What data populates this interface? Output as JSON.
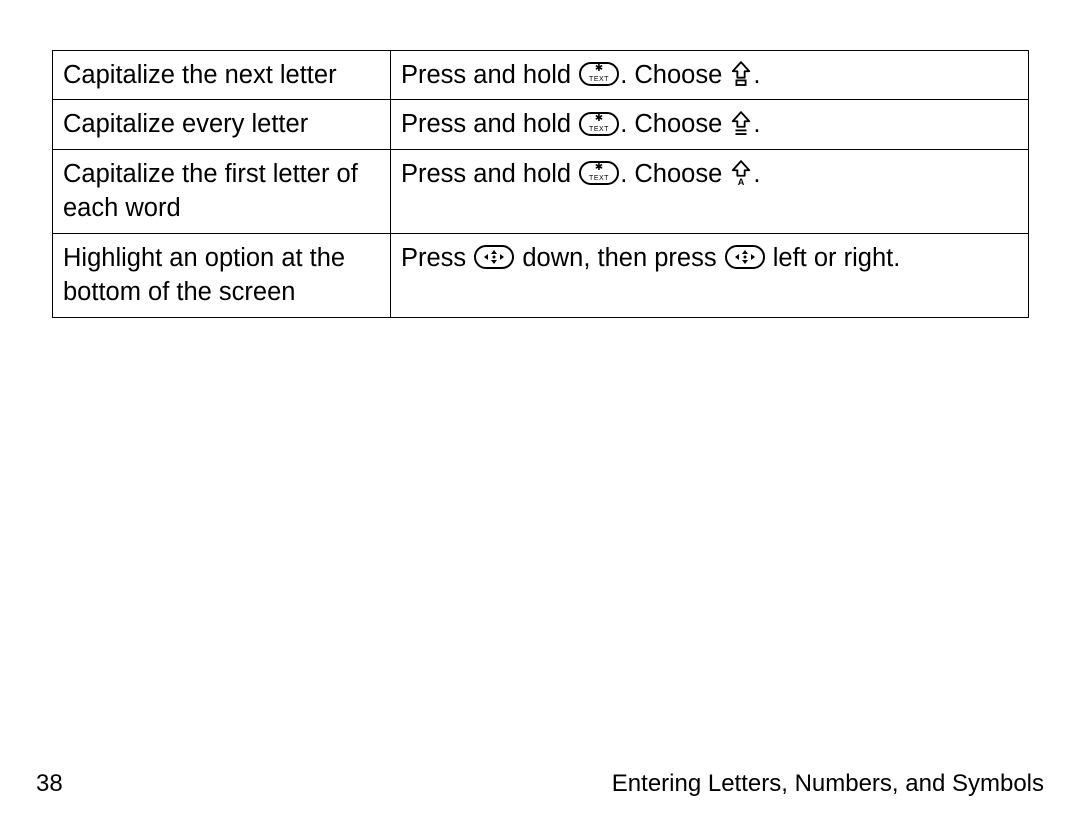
{
  "table": {
    "rows": [
      {
        "action": "Capitalize the next letter",
        "howto": {
          "segments": [
            {
              "t": "text",
              "v": "Press and hold "
            },
            {
              "t": "icon",
              "v": "text-key-icon"
            },
            {
              "t": "text",
              "v": ". Choose "
            },
            {
              "t": "icon",
              "v": "shift-next-icon"
            },
            {
              "t": "text",
              "v": "."
            }
          ]
        }
      },
      {
        "action": "Capitalize every letter",
        "howto": {
          "segments": [
            {
              "t": "text",
              "v": "Press and hold "
            },
            {
              "t": "icon",
              "v": "text-key-icon"
            },
            {
              "t": "text",
              "v": ". Choose "
            },
            {
              "t": "icon",
              "v": "shift-all-icon"
            },
            {
              "t": "text",
              "v": "."
            }
          ]
        }
      },
      {
        "action": "Capitalize the first letter of each word",
        "howto": {
          "segments": [
            {
              "t": "text",
              "v": "Press and hold "
            },
            {
              "t": "icon",
              "v": "text-key-icon"
            },
            {
              "t": "text",
              "v": ". Choose "
            },
            {
              "t": "icon",
              "v": "shift-word-icon"
            },
            {
              "t": "text",
              "v": "."
            }
          ]
        }
      },
      {
        "action": "Highlight an option at the bottom of the screen",
        "howto": {
          "segments": [
            {
              "t": "text",
              "v": "Press "
            },
            {
              "t": "icon",
              "v": "nav-key-icon"
            },
            {
              "t": "text",
              "v": " down, then press "
            },
            {
              "t": "icon",
              "v": "nav-key-icon"
            },
            {
              "t": "text",
              "v": " left or right."
            }
          ]
        }
      }
    ]
  },
  "footer": {
    "page_number": "38",
    "section_title": "Entering Letters, Numbers, and Symbols"
  }
}
